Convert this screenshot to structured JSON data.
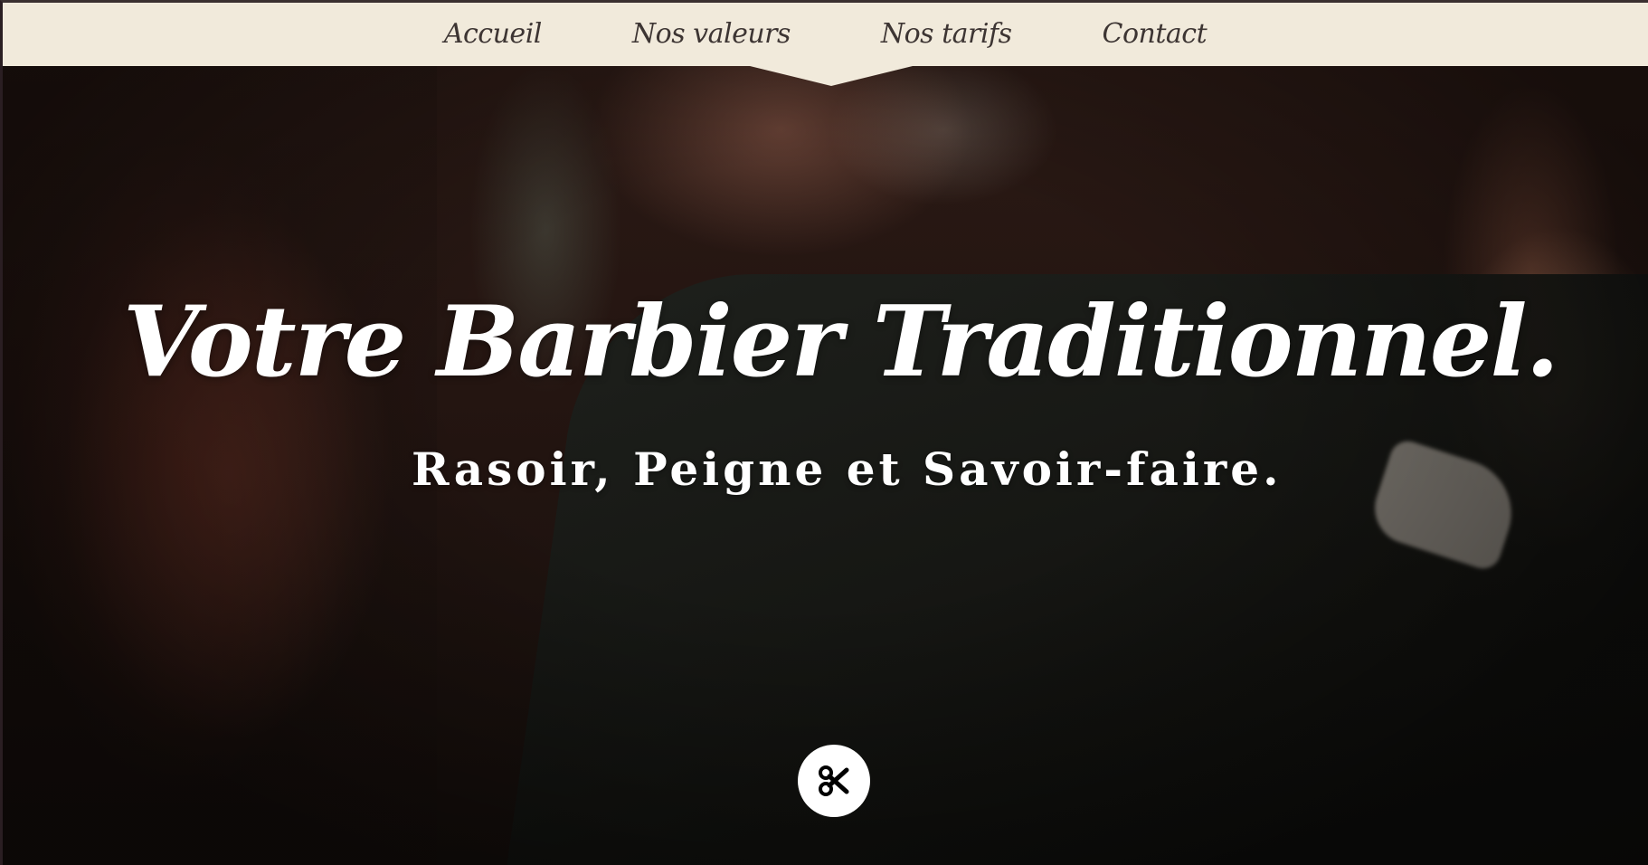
{
  "nav": {
    "items": [
      {
        "label": "Accueil"
      },
      {
        "label": "Nos valeurs"
      },
      {
        "label": "Nos tarifs"
      },
      {
        "label": "Contact"
      }
    ]
  },
  "hero": {
    "title": "Votre Barbier Traditionnel.",
    "subtitle": "Rasoir, Peigne et Savoir-faire.",
    "scroll_icon": "scissors-icon"
  },
  "colors": {
    "nav_background": "#f1eadb",
    "nav_text": "#3d3533",
    "hero_text": "#ffffff",
    "button_background": "#ffffff",
    "button_icon": "#000000"
  }
}
